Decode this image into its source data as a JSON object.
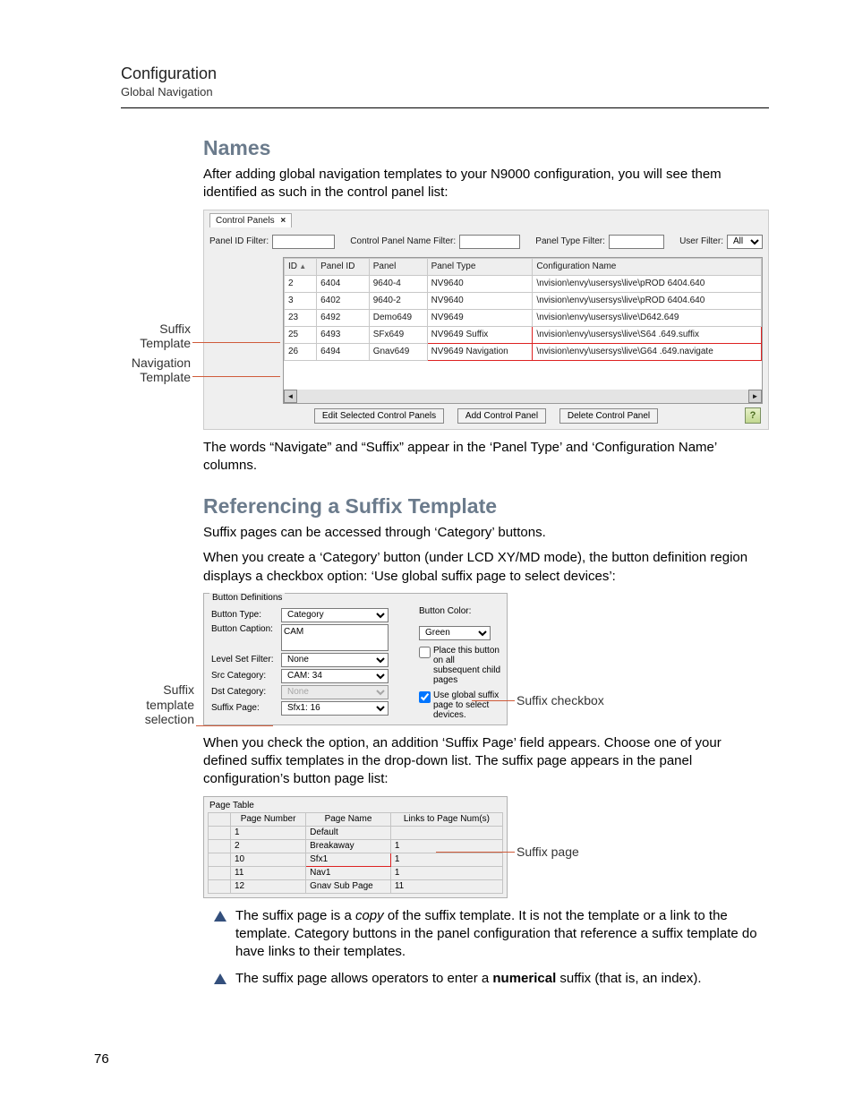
{
  "header": {
    "title": "Configuration",
    "subtitle": "Global Navigation"
  },
  "section_names": {
    "heading": "Names",
    "para": "After adding global navigation templates to your N9000 configuration, you will see them identified as such in the control panel list:"
  },
  "fig1": {
    "tab_label": "Control Panels",
    "filters": {
      "id_label": "Panel ID Filter:",
      "name_label": "Control Panel Name Filter:",
      "type_label": "Panel Type Filter:",
      "user_label": "User Filter:",
      "user_value": "All"
    },
    "columns": [
      "ID",
      "Panel ID",
      "Panel",
      "Panel Type",
      "Configuration Name"
    ],
    "rows": [
      {
        "id": "2",
        "pid": "6404",
        "panel": "9640-4",
        "type": "NV9640",
        "cfg": "\\nvision\\envy\\usersys\\live\\pROD 6404.640"
      },
      {
        "id": "3",
        "pid": "6402",
        "panel": "9640-2",
        "type": "NV9640",
        "cfg": "\\nvision\\envy\\usersys\\live\\pROD 6404.640"
      },
      {
        "id": "23",
        "pid": "6492",
        "panel": "Demo649",
        "type": "NV9649",
        "cfg": "\\nvision\\envy\\usersys\\live\\D642.649"
      },
      {
        "id": "25",
        "pid": "6493",
        "panel": "SFx649",
        "type": "NV9649 Suffix",
        "cfg": "\\nvision\\envy\\usersys\\live\\S64 .649.suffix",
        "hl": true
      },
      {
        "id": "26",
        "pid": "6494",
        "panel": "Gnav649",
        "type": "NV9649 Navigation",
        "cfg": "\\nvision\\envy\\usersys\\live\\G64 .649.navigate",
        "hl": true
      }
    ],
    "btn_edit": "Edit Selected Control Panels",
    "btn_add": "Add Control Panel",
    "btn_del": "Delete Control Panel",
    "callout_suffix": "Suffix\nTemplate",
    "callout_nav": "Navigation\nTemplate"
  },
  "after_fig1": "The words “Navigate” and “Suffix” appear in the ‘Panel Type’ and ‘Configuration Name’ columns.",
  "section_suffix": {
    "heading": "Referencing a Suffix Template",
    "p1": "Suffix pages can be accessed through ‘Category’ buttons.",
    "p2": "When you create a ‘Category’ button (under LCD XY/MD mode), the button definition region displays a checkbox option: ‘Use global suffix page to select devices’:"
  },
  "fig2": {
    "legend": "Button Definitions",
    "button_type_label": "Button Type:",
    "button_type_value": "Category",
    "caption_label": "Button Caption:",
    "caption_value": "CAM",
    "levelset_label": "Level Set Filter:",
    "levelset_value": "None",
    "src_label": "Src Category:",
    "src_value": "CAM: 34",
    "dst_label": "Dst Category:",
    "dst_value": "None",
    "suffixpage_label": "Suffix Page:",
    "suffixpage_value": "Sfx1: 16",
    "color_label": "Button Color:",
    "color_value": "Green",
    "chk1": "Place this button on all subsequent child pages",
    "chk2": "Use global suffix page to select devices.",
    "callout_left": "Suffix\ntemplate\nselection",
    "callout_right": "Suffix checkbox"
  },
  "after_fig2": "When you check the option, an addition ‘Suffix Page’ field appears. Choose one of your defined suffix templates in the drop-down list. The suffix page appears in the panel configuration’s button page list:",
  "fig3": {
    "title": "Page Table",
    "columns": [
      "Page Number",
      "Page Name",
      "Links to Page Num(s)"
    ],
    "rows": [
      {
        "num": "1",
        "name": "Default",
        "links": ""
      },
      {
        "num": "2",
        "name": "Breakaway",
        "links": "1"
      },
      {
        "num": "10",
        "name": "Sfx1",
        "links": "1",
        "hl": true
      },
      {
        "num": "11",
        "name": "Nav1",
        "links": "1"
      },
      {
        "num": "12",
        "name": "Gnav Sub Page",
        "links": "11"
      }
    ],
    "callout": "Suffix page"
  },
  "notes": {
    "n1a": "The suffix page is a ",
    "n1b": "copy",
    "n1c": " of the suffix template. It is not the template or a link to the template. Category buttons in the panel configuration that reference a suffix template do have links to their templates.",
    "n2a": "The suffix page allows operators to enter a ",
    "n2b": "numerical",
    "n2c": " suffix (that is, an index)."
  },
  "page_num": "76"
}
